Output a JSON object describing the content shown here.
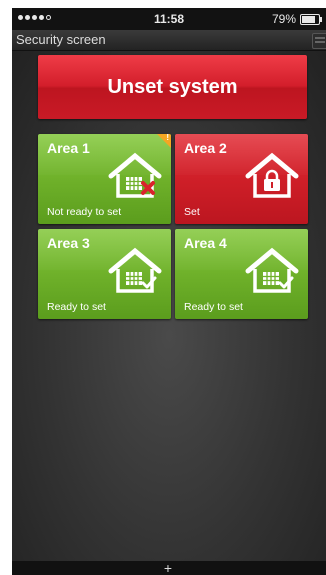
{
  "status_bar": {
    "time": "11:58",
    "battery_percent": "79%",
    "battery_level": 0.79,
    "signal_bars_filled": 4,
    "signal_bars_total": 5
  },
  "titlebar": {
    "title": "Security screen",
    "menu_icon": "menu-icon"
  },
  "unset_button": {
    "label": "Unset system",
    "color": "#d31e2b"
  },
  "areas": [
    {
      "name": "Area 1",
      "status": "Not ready to set",
      "color": "#6fb12a",
      "icon": "house-grid-cross-icon",
      "warning": "!"
    },
    {
      "name": "Area 2",
      "status": "Set",
      "color": "#cf1f28",
      "icon": "house-lock-icon"
    },
    {
      "name": "Area 3",
      "status": "Ready to set",
      "color": "#6fb12a",
      "icon": "house-grid-check-icon"
    },
    {
      "name": "Area 4",
      "status": "Ready to set",
      "color": "#6fb12a",
      "icon": "house-grid-check-icon"
    }
  ],
  "bottom_bar": {
    "add_icon": "plus-icon",
    "add_glyph": "+"
  }
}
